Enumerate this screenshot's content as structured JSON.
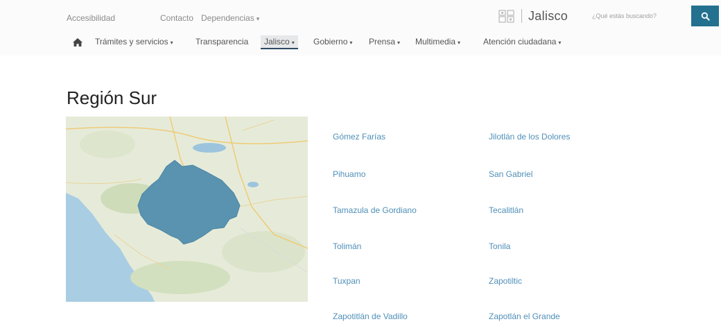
{
  "utility_links": [
    {
      "label": "Accesibilidad"
    },
    {
      "label": "Contacto"
    },
    {
      "label": "Dependencias",
      "caret": "▾"
    }
  ],
  "logo": {
    "text": "Jalisco"
  },
  "search": {
    "placeholder": "¿Qué estás buscando?",
    "icon": "search-icon"
  },
  "nav": {
    "home_icon": "home-icon",
    "items": [
      {
        "label": "Trámites y servicios",
        "caret": "▾"
      },
      {
        "label": "Transparencia"
      },
      {
        "label": "Jalisco",
        "caret": "▾",
        "active": true
      },
      {
        "label": "Gobierno",
        "caret": "▾"
      },
      {
        "label": "Prensa",
        "caret": "▾"
      },
      {
        "label": "Multimedia",
        "caret": "▾"
      },
      {
        "label": "Atención ciudadana",
        "caret": "▾"
      }
    ]
  },
  "page": {
    "title": "Región Sur",
    "municipalities_left": [
      "Gómez Farías",
      "Pihuamo",
      "Tamazula de Gordiano",
      "Tolimán",
      "Tuxpan",
      "Zapotitlán de Vadillo"
    ],
    "municipalities_right": [
      "Jilotlán de los Dolores",
      "San Gabriel",
      "Tecalitlán",
      "Tonila",
      "Zapotiltic",
      "Zapotlán el Grande"
    ]
  },
  "colors": {
    "accent": "#23718f",
    "link": "#4f8fb8",
    "region": "#5a93b0"
  }
}
